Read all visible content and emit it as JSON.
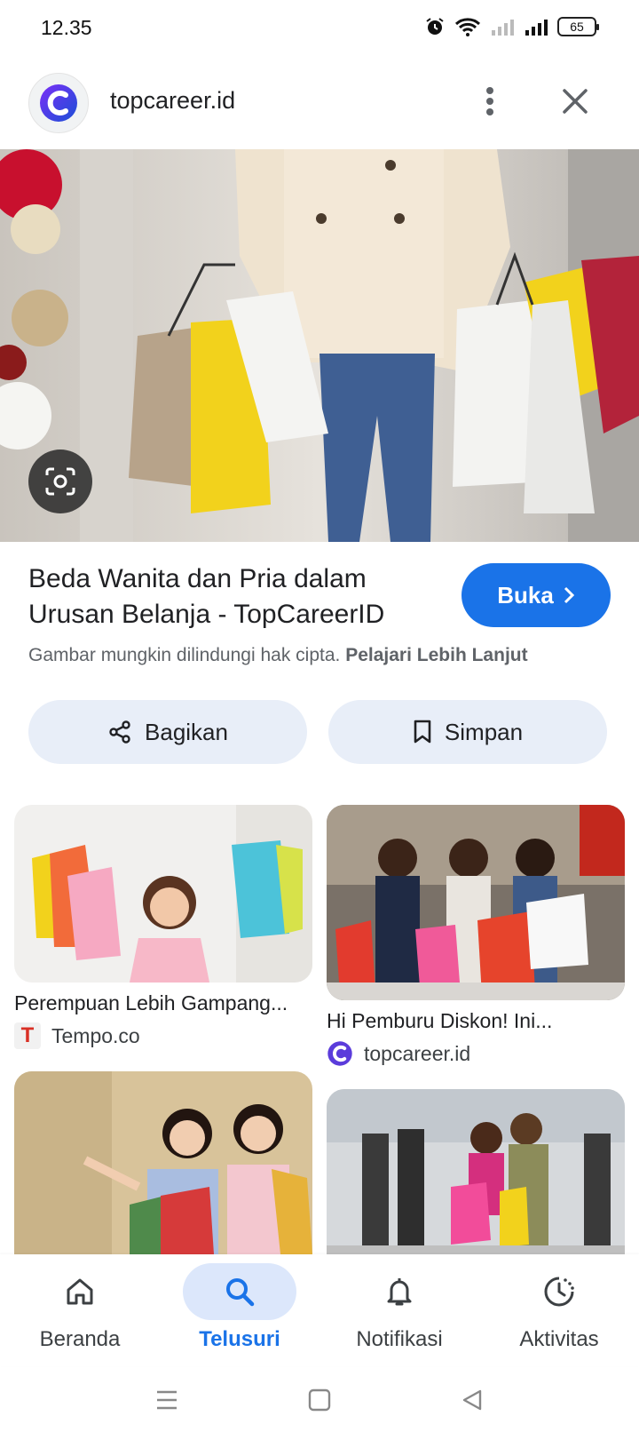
{
  "status_bar": {
    "time": "12.35",
    "battery": "65"
  },
  "header": {
    "site_name": "topcareer.id"
  },
  "result": {
    "title": "Beda Wanita dan Pria dalam Urusan Belanja - TopCareerID",
    "open_label": "Buka",
    "copyright_text": "Gambar mungkin dilindungi hak cipta.",
    "learn_more": "Pelajari Lebih Lanjut"
  },
  "actions": {
    "share_label": "Bagikan",
    "save_label": "Simpan"
  },
  "related": [
    {
      "title": "Perempuan Lebih Gampang...",
      "source": "Tempo.co"
    },
    {
      "title": "Hi Pemburu Diskon! Ini...",
      "source": "topcareer.id"
    }
  ],
  "bottom_nav": [
    {
      "label": "Beranda",
      "icon": "home-icon"
    },
    {
      "label": "Telusuri",
      "icon": "search-icon"
    },
    {
      "label": "Notifikasi",
      "icon": "bell-icon"
    },
    {
      "label": "Aktivitas",
      "icon": "activity-icon"
    }
  ],
  "colors": {
    "accent": "#1a73e8",
    "chip_bg": "#e8eef8",
    "nav_active_bg": "#dce7fb"
  }
}
